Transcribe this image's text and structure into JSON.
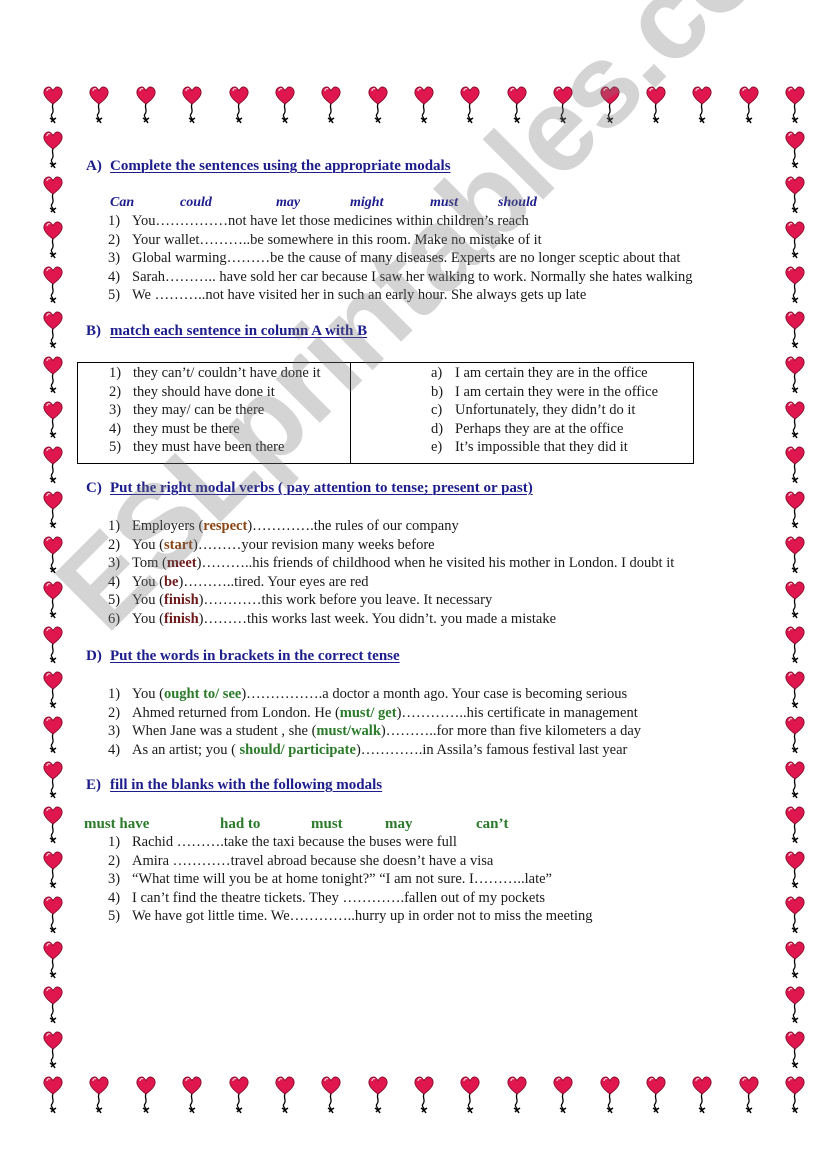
{
  "watermark": "ESLprintables.com",
  "colors": {
    "heading": "#1c1c8c",
    "heart": "#e0164f",
    "bracket_brown": "#8b4513",
    "bracket_maroon": "#6e1a1a",
    "green": "#2a7a2a"
  },
  "sections": {
    "A": {
      "letter": "A)",
      "title": "Complete the sentences using the appropriate modals",
      "word_bank": [
        "Can",
        "could",
        "may",
        "might",
        "must",
        "should"
      ],
      "items": [
        {
          "num": "1)",
          "text": "You……………not have let those medicines within children’s reach"
        },
        {
          "num": "2)",
          "text": "Your wallet………..be somewhere in this room. Make no mistake of it"
        },
        {
          "num": "3)",
          "text": "Global warming………be the cause of many diseases. Experts are no longer sceptic about that"
        },
        {
          "num": "4)",
          "text": "Sarah……….. have sold her car because I saw her walking to work. Normally she hates walking"
        },
        {
          "num": "5)",
          "text": "We ………..not have visited her in such an early hour. She always gets up late"
        }
      ]
    },
    "B": {
      "letter": "B)",
      "title": "match each sentence in column A with B",
      "column_a": [
        {
          "num": "1)",
          "text": "they can’t/ couldn’t have done it"
        },
        {
          "num": "2)",
          "text": "they should have done it"
        },
        {
          "num": "3)",
          "text": "they may/ can be there"
        },
        {
          "num": "4)",
          "text": "they must be there"
        },
        {
          "num": "5)",
          "text": "they must have been there"
        }
      ],
      "column_b": [
        {
          "num": "a)",
          "text": "I am certain they are in the office"
        },
        {
          "num": "b)",
          "text": "I am certain they were in the office"
        },
        {
          "num": "c)",
          "text": "Unfortunately, they didn’t do it"
        },
        {
          "num": "d)",
          "text": "Perhaps they are at the office"
        },
        {
          "num": "e)",
          "text": "It’s impossible that they did it"
        }
      ]
    },
    "C": {
      "letter": "C)",
      "title": "Put the right modal verbs ( pay attention to tense; present or past)",
      "items": [
        {
          "num": "1)",
          "before": "Employers (",
          "verb": "respect",
          "after": ")………….the rules of our company"
        },
        {
          "num": "2)",
          "before": "You (",
          "verb": "start",
          "after": ")………your revision many weeks before"
        },
        {
          "num": "3)",
          "before": "Tom (",
          "verb": "meet",
          "after": ")………..his friends of childhood when he visited his mother in London. I doubt it"
        },
        {
          "num": "4)",
          "before": "You (",
          "verb": "be",
          "after": ")………..tired. Your eyes are red"
        },
        {
          "num": "5)",
          "before": "You (",
          "verb": "finish",
          "after": ")…………this work before you leave. It necessary"
        },
        {
          "num": "6)",
          "before": "You (",
          "verb": "finish",
          "after": ")………this works last week. You didn’t. you made a mistake"
        }
      ]
    },
    "D": {
      "letter": "D)",
      "title": "Put the words in brackets in the correct tense",
      "items": [
        {
          "num": "1)",
          "before": "You (",
          "verb": "ought to/ see",
          "after": ")…………….a doctor a month ago. Your case is becoming serious"
        },
        {
          "num": "2)",
          "before": "Ahmed returned from London. He (",
          "verb": "must/ get",
          "after": ")…………..his certificate in management"
        },
        {
          "num": "3)",
          "before": "When Jane was a student , she (",
          "verb": "must/walk",
          "after": ")………..for more than five kilometers a day"
        },
        {
          "num": "4)",
          "before": "As an artist; you ( ",
          "verb": "should/ participate",
          "after": ")………….in Assila’s famous festival last year"
        }
      ]
    },
    "E": {
      "letter": "E)",
      "title": "fill in the blanks with the following modals",
      "word_bank": [
        "must have",
        "had to",
        "must",
        "may",
        "can’t"
      ],
      "items": [
        {
          "num": "1)",
          "text": "Rachid ……….take the taxi because the buses were full"
        },
        {
          "num": "2)",
          "text": "Amira …………travel abroad because she doesn’t have a visa"
        },
        {
          "num": "3)",
          "text": "“What time will you be at home tonight?” “I am not sure. I………..late”"
        },
        {
          "num": "4)",
          "text": "I can’t find the theatre tickets. They ………….fallen out of my pockets"
        },
        {
          "num": "5)",
          "text": "We have got little time. We…………..hurry up in order not to miss the meeting"
        }
      ]
    }
  }
}
